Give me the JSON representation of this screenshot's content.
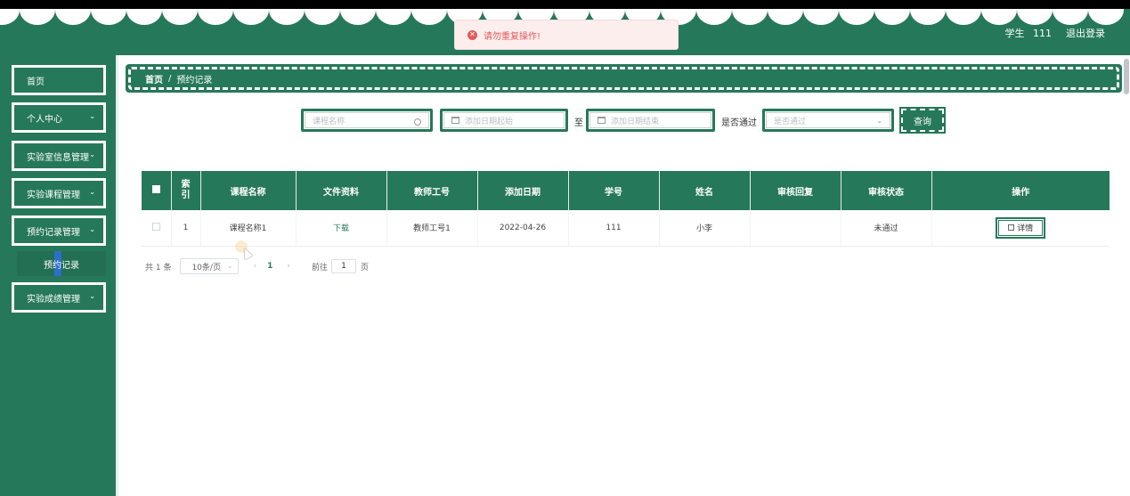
{
  "header": {
    "role_label": "学生",
    "user_id": "111",
    "logout_label": "退出登录",
    "bg_color": "#26785a"
  },
  "toast": {
    "icon": "error-circle-icon",
    "message": "请勿重复操作!"
  },
  "sidebar": {
    "items": [
      {
        "label": "首页",
        "has_dropdown": false
      },
      {
        "label": "个人中心",
        "has_dropdown": true
      },
      {
        "label": "实验室信息管理",
        "has_dropdown": true
      },
      {
        "label": "实验课程管理",
        "has_dropdown": true
      },
      {
        "label": "预约记录管理",
        "has_dropdown": true,
        "expanded": true
      },
      {
        "label": "实验成绩管理",
        "has_dropdown": true
      }
    ],
    "submenu": {
      "label": "预约记录"
    }
  },
  "breadcrumb": {
    "home": "首页",
    "separator": "/",
    "current": "预约记录"
  },
  "filters": {
    "course_name_placeholder": "课程名称",
    "date_start_placeholder": "添加日期起始",
    "date_to_label": "至",
    "date_end_placeholder": "添加日期结束",
    "approved_label": "是否通过",
    "approved_placeholder": "是否通过",
    "query_button": "查询"
  },
  "table": {
    "columns": [
      "索引",
      "课程名称",
      "文件资料",
      "教师工号",
      "添加日期",
      "学号",
      "姓名",
      "审核回复",
      "审核状态",
      "操作"
    ],
    "rows": [
      {
        "index": "1",
        "course_name": "课程名称1",
        "file": "下载",
        "teacher_id": "教师工号1",
        "date": "2022-04-26",
        "student_id": "111",
        "name": "小李",
        "review_reply": "",
        "review_status": "未通过",
        "action": "详情"
      }
    ]
  },
  "pagination": {
    "total": "共 1 条",
    "page_size": "10条/页",
    "prev": "‹",
    "current_page": "1",
    "next": "›",
    "goto_label": "前往",
    "goto_value": "1",
    "page_suffix": "页"
  }
}
